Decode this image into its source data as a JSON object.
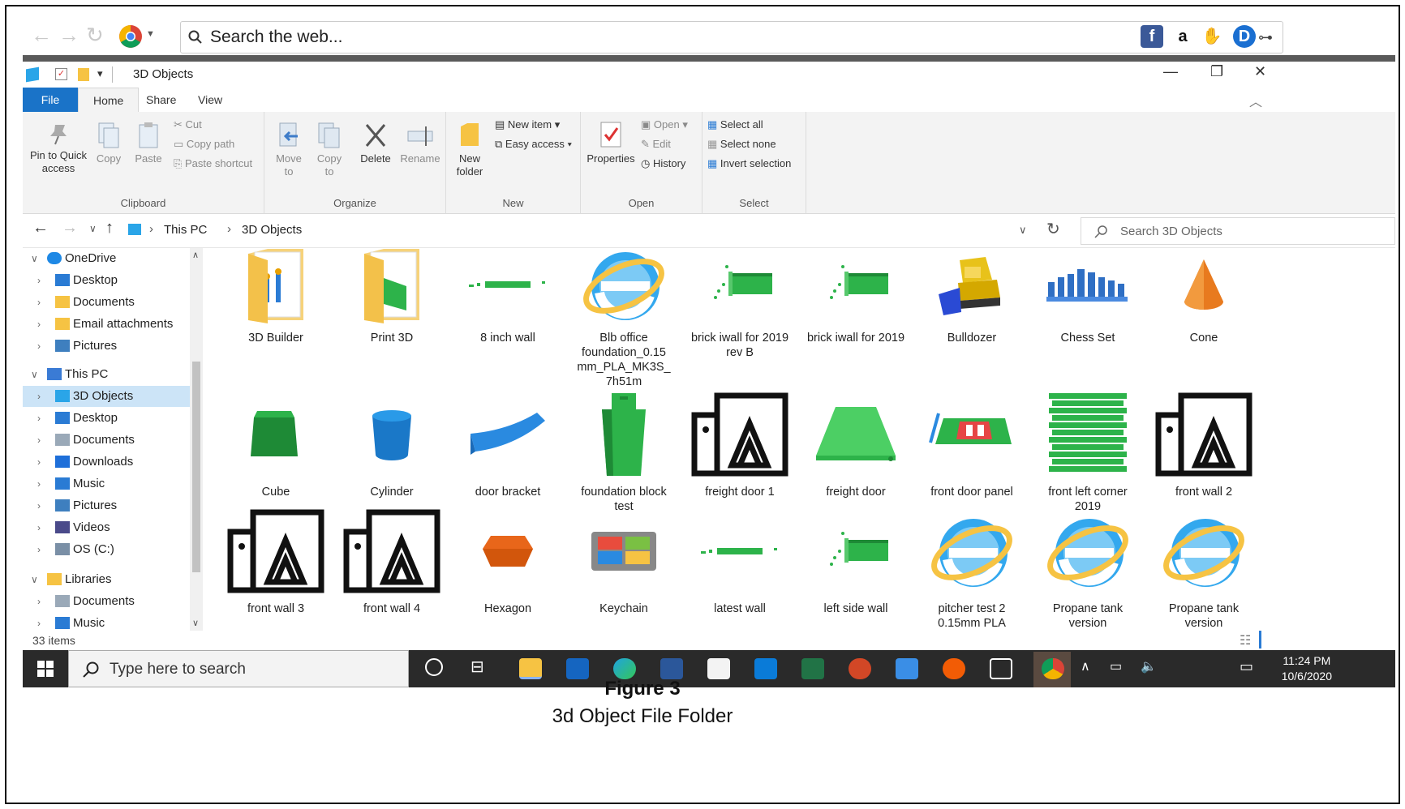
{
  "browser": {
    "search_placeholder": "Search the web..."
  },
  "window": {
    "title": "3D Objects"
  },
  "ribbon_tabs": [
    "File",
    "Home",
    "Share",
    "View"
  ],
  "ribbon": {
    "clipboard": {
      "label": "Clipboard",
      "pin": "Pin to Quick access",
      "copy": "Copy",
      "paste": "Paste",
      "cut": "Cut",
      "copy_path": "Copy path",
      "paste_shortcut": "Paste shortcut"
    },
    "organize": {
      "label": "Organize",
      "move_to": "Move to",
      "copy_to": "Copy to",
      "delete": "Delete",
      "rename": "Rename"
    },
    "new": {
      "label": "New",
      "new_folder": "New folder",
      "new_item": "New item",
      "easy_access": "Easy access"
    },
    "open": {
      "label": "Open",
      "properties": "Properties",
      "open": "Open",
      "edit": "Edit",
      "history": "History"
    },
    "select": {
      "label": "Select",
      "select_all": "Select all",
      "select_none": "Select none",
      "invert": "Invert selection"
    }
  },
  "address": {
    "crumbs": [
      "This PC",
      "3D Objects"
    ],
    "search_placeholder": "Search 3D Objects"
  },
  "nav": [
    {
      "label": "OneDrive",
      "level": 0,
      "expanded": true,
      "icon": "cloud-icon"
    },
    {
      "label": "Desktop",
      "level": 1,
      "icon": "desktop-icon"
    },
    {
      "label": "Documents",
      "level": 1,
      "icon": "folder-icon"
    },
    {
      "label": "Email attachments",
      "level": 1,
      "icon": "folder-icon"
    },
    {
      "label": "Pictures",
      "level": 1,
      "icon": "pictures-icon"
    },
    {
      "label": "This PC",
      "level": 0,
      "expanded": true,
      "icon": "pc-icon"
    },
    {
      "label": "3D Objects",
      "level": 1,
      "selected": true,
      "icon": "cube-icon"
    },
    {
      "label": "Desktop",
      "level": 1,
      "icon": "desktop-icon"
    },
    {
      "label": "Documents",
      "level": 1,
      "icon": "documents-icon"
    },
    {
      "label": "Downloads",
      "level": 1,
      "icon": "download-icon"
    },
    {
      "label": "Music",
      "level": 1,
      "icon": "music-icon"
    },
    {
      "label": "Pictures",
      "level": 1,
      "icon": "pictures-icon"
    },
    {
      "label": "Videos",
      "level": 1,
      "icon": "videos-icon"
    },
    {
      "label": "OS (C:)",
      "level": 1,
      "icon": "drive-icon"
    },
    {
      "label": "Libraries",
      "level": 0,
      "expanded": true,
      "icon": "libraries-icon"
    },
    {
      "label": "Documents",
      "level": 1,
      "icon": "documents-icon"
    },
    {
      "label": "Music",
      "level": 1,
      "icon": "music-icon"
    }
  ],
  "items": [
    {
      "label": "3D Builder",
      "icon": "folder-3d-builder-icon"
    },
    {
      "label": "Print 3D",
      "icon": "folder-print3d-icon"
    },
    {
      "label": "8 inch wall",
      "icon": "model-wall-icon"
    },
    {
      "label": "Blb office foundation_0.15 mm_PLA_MK3S_ 7h51m",
      "icon": "ie-icon"
    },
    {
      "label": "brick iwall for 2019 rev B",
      "icon": "model-brick-icon"
    },
    {
      "label": "brick iwall for 2019",
      "icon": "model-brick-icon"
    },
    {
      "label": "Bulldozer",
      "icon": "bulldozer-icon"
    },
    {
      "label": "Chess Set",
      "icon": "chess-icon"
    },
    {
      "label": "Cone",
      "icon": "cone-icon"
    },
    {
      "label": "Cube",
      "icon": "cube-icon"
    },
    {
      "label": "Cylinder",
      "icon": "cylinder-icon"
    },
    {
      "label": "door bracket",
      "icon": "bracket-icon"
    },
    {
      "label": "foundation block test",
      "icon": "block-icon"
    },
    {
      "label": "freight door 1",
      "icon": "3d-viewer-icon"
    },
    {
      "label": "freight door",
      "icon": "ramp-icon"
    },
    {
      "label": "front door panel",
      "icon": "panel-icon"
    },
    {
      "label": "front left corner 2019",
      "icon": "stack-icon"
    },
    {
      "label": "front wall 2",
      "icon": "3d-viewer-icon"
    },
    {
      "label": "front wall 3",
      "icon": "3d-viewer-icon"
    },
    {
      "label": "front wall 4",
      "icon": "3d-viewer-icon"
    },
    {
      "label": "Hexagon",
      "icon": "hexagon-icon"
    },
    {
      "label": "Keychain",
      "icon": "keychain-icon"
    },
    {
      "label": "latest wall",
      "icon": "model-wall-icon"
    },
    {
      "label": "left side wall",
      "icon": "model-brick-icon"
    },
    {
      "label": "pitcher test 2 0.15mm PLA",
      "icon": "ie-icon"
    },
    {
      "label": "Propane tank version",
      "icon": "ie-icon"
    },
    {
      "label": "Propane tank version",
      "icon": "ie-icon"
    }
  ],
  "status": {
    "count": "33 items"
  },
  "taskbar": {
    "search_placeholder": "Type here to search",
    "time": "11:24 PM",
    "date": "10/6/2020"
  },
  "caption": {
    "title": "Figure 3",
    "subtitle": "3d Object File Folder"
  },
  "colors": {
    "accent": "#1a73c8",
    "model_green": "#2db34a",
    "selected_bg": "#cce4f7",
    "taskbar": "#2a2a2a"
  }
}
